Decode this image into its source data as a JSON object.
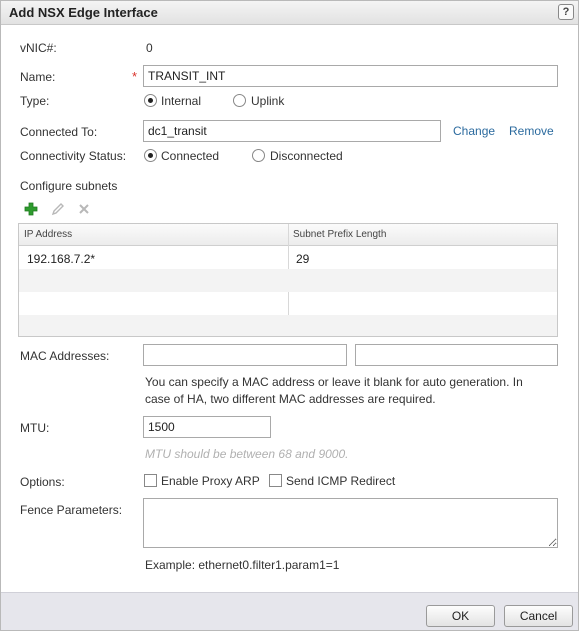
{
  "dialog": {
    "title": "Add NSX Edge Interface",
    "help_label": "?"
  },
  "form": {
    "vnic_label": "vNIC#:",
    "vnic_value": "0",
    "name_label": "Name:",
    "name_required_mark": "*",
    "name_value": "TRANSIT_INT",
    "type_label": "Type:",
    "type_options": [
      {
        "label": "Internal",
        "selected": true
      },
      {
        "label": "Uplink",
        "selected": false
      }
    ],
    "connected_to_label": "Connected To:",
    "connected_to_value": "dc1_transit",
    "change_link": "Change",
    "remove_link": "Remove",
    "connectivity_label": "Connectivity Status:",
    "connectivity_options": [
      {
        "label": "Connected",
        "selected": true
      },
      {
        "label": "Disconnected",
        "selected": false
      }
    ],
    "configure_subnets_label": "Configure subnets",
    "subnets_toolbar": {
      "add_icon": "add-icon",
      "edit_icon": "edit-icon",
      "delete_icon": "delete-icon"
    },
    "subnets_table": {
      "columns": [
        "IP Address",
        "Subnet Prefix Length"
      ],
      "rows": [
        [
          "192.168.7.2*",
          "29"
        ]
      ]
    },
    "mac_label": "MAC Addresses:",
    "mac_value_1": "",
    "mac_value_2": "",
    "mac_help": "You can specify a MAC address or leave it blank for auto generation. In case of HA, two different MAC addresses are required.",
    "mtu_label": "MTU:",
    "mtu_value": "1500",
    "mtu_hint": "MTU should be between 68 and 9000.",
    "options_label": "Options:",
    "option_proxy_arp": "Enable Proxy ARP",
    "option_icmp_redirect": "Send ICMP Redirect",
    "fence_label": "Fence Parameters:",
    "fence_value": "",
    "fence_example": "Example: ethernet0.filter1.param1=1"
  },
  "footer": {
    "ok_label": "OK",
    "cancel_label": "Cancel"
  },
  "colors": {
    "link": "#2b6a9e",
    "required": "#d9322b",
    "add_icon": "#2e9b2e"
  }
}
